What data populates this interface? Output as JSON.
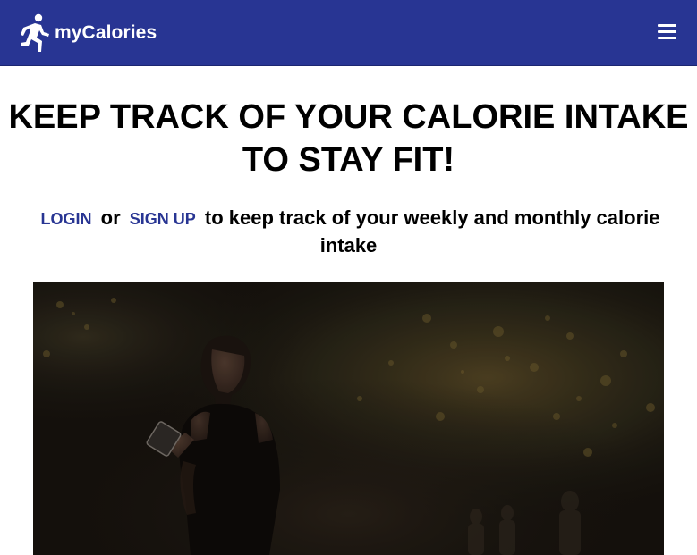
{
  "navbar": {
    "brand_name": "myCalories",
    "brand_icon": "running-person-icon",
    "menu_icon": "hamburger-menu-icon",
    "background_color": "#283593"
  },
  "hero": {
    "headline": "KEEP TRACK OF YOUR CALORIE INTAKE TO STAY FIT!",
    "login_label": "LOGIN",
    "connector": "or",
    "signup_label": "SIGN UP",
    "tagline_rest": "to keep track of your weekly and monthly calorie intake",
    "link_color": "#283593"
  }
}
